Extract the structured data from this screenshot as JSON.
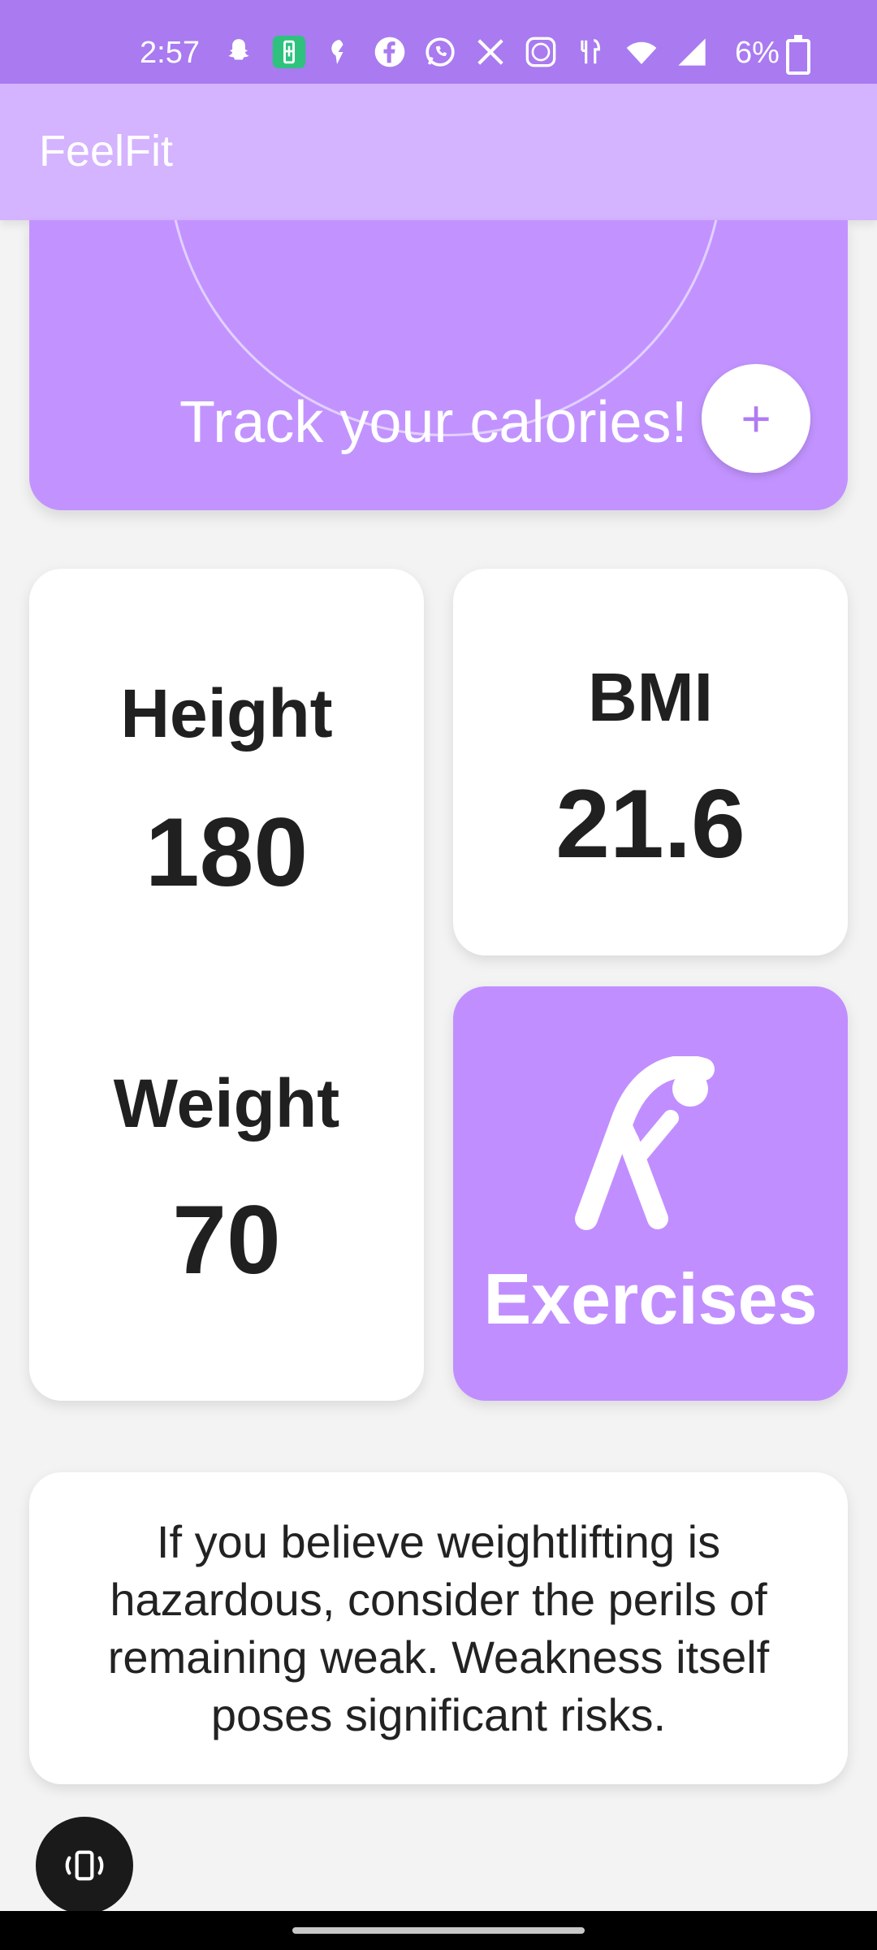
{
  "status_bar": {
    "time": "2:57",
    "battery_percent": "6%",
    "icons": [
      "snapchat-icon",
      "battery-saver-icon",
      "notification-icon",
      "facebook-icon",
      "whatsapp-icon",
      "x-icon",
      "cb-icon",
      "food-icon",
      "wifi-icon",
      "signal-icon",
      "battery-icon"
    ]
  },
  "app_bar": {
    "title": "FeelFit"
  },
  "calories_card": {
    "label": "Track your calories!",
    "add_button": "+"
  },
  "stats": {
    "height_label": "Height",
    "height_value": "180",
    "weight_label": "Weight",
    "weight_value": "70",
    "bmi_label": "BMI",
    "bmi_value": "21.6"
  },
  "exercises": {
    "label": "Exercises"
  },
  "quote": {
    "text": "If you believe weightlifting is hazardous, consider the perils of remaining weak. Weakness itself poses significant risks."
  },
  "colors": {
    "status_bar": "#a97af0",
    "app_bar": "#d4b3ff",
    "accent": "#c18eff",
    "background": "#f3f3f3"
  }
}
